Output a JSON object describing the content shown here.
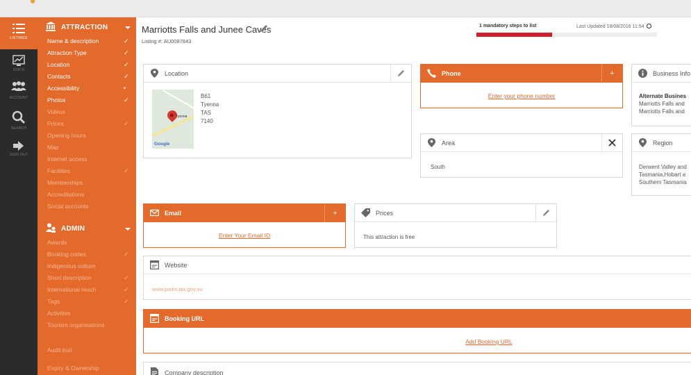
{
  "rail": [
    {
      "label": "LISTINGS",
      "icon": "list-icon",
      "active": true
    },
    {
      "label": "STATS",
      "icon": "chart-icon",
      "active": false
    },
    {
      "label": "ACCOUNT",
      "icon": "users-icon",
      "active": false
    },
    {
      "label": "SEARCH",
      "icon": "search-icon",
      "active": false
    },
    {
      "label": "SIGN OUT",
      "icon": "sign-out-icon",
      "active": false
    }
  ],
  "menu": {
    "attraction_title": "ATTRACTION",
    "attraction_items": [
      {
        "label": "Name & description",
        "mark": "✓",
        "dim": false
      },
      {
        "label": "Attraction Type",
        "mark": "✓",
        "dim": false
      },
      {
        "label": "Location",
        "mark": "✓",
        "dim": false
      },
      {
        "label": "Contacts",
        "mark": "✓",
        "dim": false
      },
      {
        "label": "Accessibility",
        "mark": "•",
        "dim": false
      },
      {
        "label": "Photos",
        "mark": "✓",
        "dim": false
      },
      {
        "label": "Videos",
        "mark": "",
        "dim": true
      },
      {
        "label": "Prices",
        "mark": "✓",
        "dim": true
      },
      {
        "label": "Opening hours",
        "mark": "",
        "dim": true
      },
      {
        "label": "Map",
        "mark": "",
        "dim": true
      },
      {
        "label": "Internet access",
        "mark": "",
        "dim": true
      },
      {
        "label": "Facilities",
        "mark": "✓",
        "dim": true
      },
      {
        "label": "Memberships",
        "mark": "",
        "dim": true
      },
      {
        "label": "Accreditations",
        "mark": "",
        "dim": true
      },
      {
        "label": "Social accounts",
        "mark": "",
        "dim": true
      }
    ],
    "admin_title": "ADMIN",
    "admin_items": [
      {
        "label": "Awards",
        "mark": "",
        "dim": true
      },
      {
        "label": "Booking codes",
        "mark": "✓",
        "dim": true
      },
      {
        "label": "Indigenous culture",
        "mark": "",
        "dim": true
      },
      {
        "label": "Short description",
        "mark": "✓",
        "dim": true
      },
      {
        "label": "International reach",
        "mark": "✓",
        "dim": true
      },
      {
        "label": "Tags",
        "mark": "✓",
        "dim": true
      },
      {
        "label": "Activities",
        "mark": "",
        "dim": true
      },
      {
        "label": "Tourism organisations",
        "mark": "",
        "dim": true
      }
    ],
    "audit_trail": "Audit trail",
    "expiry": "Expiry & Ownership"
  },
  "header": {
    "title": "Marriotts Falls and Junee Caves",
    "listing_no": "Listing #: AU0087843",
    "mandatory": "1 mandatory steps to list",
    "progress": 0.42,
    "updated": "Last Updated 18/08/2016 11:54"
  },
  "location": {
    "label": "Location",
    "address": [
      "B61",
      "Tyenna",
      "TAS",
      "7140"
    ],
    "map_label": "Tyenna",
    "map_brand": "Google"
  },
  "phone": {
    "label": "Phone",
    "add": "+",
    "link": "Enter your phone number"
  },
  "business": {
    "label": "Business Info",
    "heading": "Alternate Busines",
    "lines": [
      "Marriotts Falls and",
      "Marriotts Falls and"
    ]
  },
  "area": {
    "label": "Area",
    "value": "South"
  },
  "region": {
    "label": "Region",
    "lines": [
      "Derwent Valley and",
      "Tasmania,Hobart a",
      "Southern Tasmania"
    ]
  },
  "email": {
    "label": "Email",
    "add": "+",
    "link": "Enter Your Email ID"
  },
  "prices": {
    "label": "Prices",
    "value": "This attraction is free"
  },
  "website": {
    "label": "Website",
    "value": "www.parks.tas.gov.au"
  },
  "booking": {
    "label": "Booking URL",
    "link": "Add Booking URL"
  },
  "company": {
    "label": "Company description"
  },
  "colors": {
    "accent": "#e46a2b",
    "rail": "#2b2b2b",
    "progress": "#cf1f2b"
  }
}
